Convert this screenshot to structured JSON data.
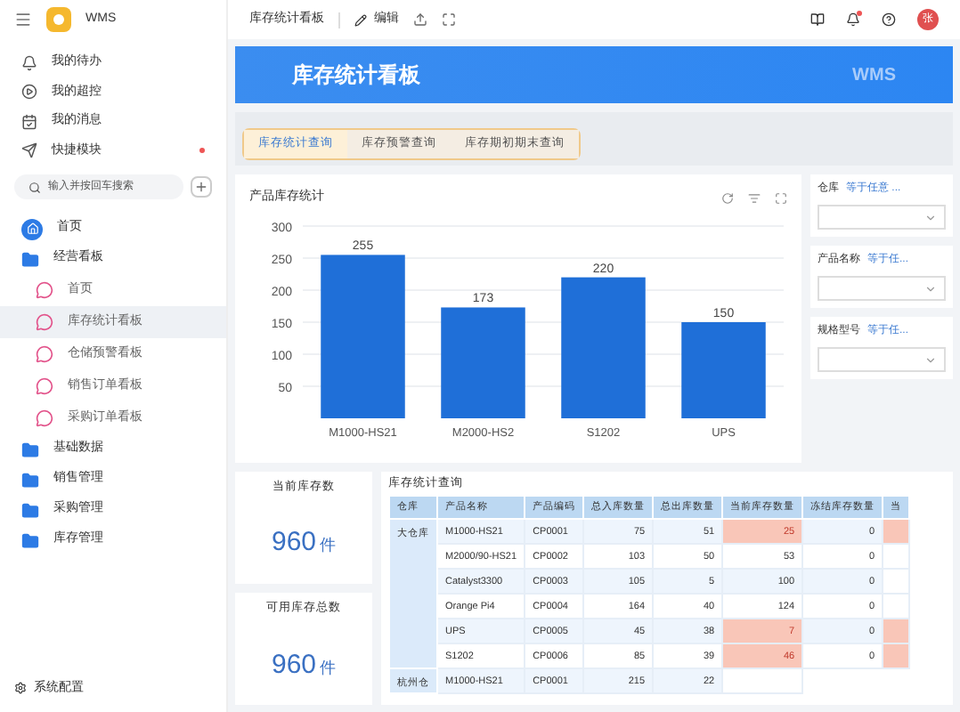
{
  "app": {
    "logo_text": "WMS"
  },
  "sidebar": {
    "shortcuts": [
      {
        "label": "我的待办",
        "badge": false
      },
      {
        "label": "我的超控",
        "badge": false
      },
      {
        "label": "我的消息",
        "badge": false
      },
      {
        "label": "快捷模块",
        "badge": true
      }
    ],
    "search": {
      "placeholder": "输入并按回车搜索"
    },
    "menu": [
      {
        "kind": "home",
        "label": "首页"
      },
      {
        "kind": "folder",
        "label": "经营看板",
        "children": [
          {
            "label": "首页",
            "selected": false
          },
          {
            "label": "库存统计看板",
            "selected": true
          },
          {
            "label": "仓储预警看板",
            "selected": false
          },
          {
            "label": "销售订单看板",
            "selected": false
          },
          {
            "label": "采购订单看板",
            "selected": false
          }
        ]
      },
      {
        "kind": "folder",
        "label": "基础数据"
      },
      {
        "kind": "folder",
        "label": "销售管理"
      },
      {
        "kind": "folder",
        "label": "采购管理"
      },
      {
        "kind": "folder",
        "label": "库存管理"
      }
    ],
    "footer": "系统配置"
  },
  "topbar": {
    "title": "库存统计看板",
    "edit": "编辑",
    "notification_dot": true,
    "avatar": "张"
  },
  "banner": {
    "title": "库存统计看板",
    "mark": "WMS"
  },
  "tabs": [
    {
      "label": "库存统计查询",
      "selected": true
    },
    {
      "label": "库存预警查询",
      "selected": false
    },
    {
      "label": "库存期初期末查询",
      "selected": false
    }
  ],
  "chart_panel": {
    "title": "产品库存统计",
    "chart_data": {
      "type": "bar",
      "categories": [
        "M1000-HS21",
        "M2000-HS2",
        "S1202",
        "UPS"
      ],
      "series": [
        {
          "color": "#1f6fd8",
          "values": [
            255,
            173,
            220,
            150
          ]
        }
      ],
      "ylim": [
        0,
        300
      ],
      "yticks": [
        50,
        100,
        150,
        200,
        250,
        300
      ],
      "grid": true,
      "data_labels": true
    }
  },
  "filters": [
    {
      "label": "仓库",
      "operator": "等于任意 ..."
    },
    {
      "label": "产品名称",
      "operator": "等于任..."
    },
    {
      "label": "规格型号",
      "operator": "等于任..."
    }
  ],
  "stat_cards": [
    {
      "title": "当前库存数",
      "value": "960",
      "unit": "件"
    },
    {
      "title": "可用库存总数",
      "value": "960",
      "unit": "件"
    }
  ],
  "table": {
    "title": "库存统计查询",
    "columns": [
      "仓库",
      "产品名称",
      "产品编码",
      "总入库数量",
      "总出库数量",
      "当前库存数量",
      "冻结库存数量",
      "当"
    ],
    "groups": [
      {
        "warehouse": "大仓库",
        "rows": [
          {
            "cells": [
              "M1000-HS21",
              "CP0001",
              "75",
              "51",
              "25",
              "0"
            ],
            "warning": true
          },
          {
            "cells": [
              "M2000/90-HS21",
              "CP0002",
              "103",
              "50",
              "53",
              "0"
            ],
            "warning": false
          },
          {
            "cells": [
              "Catalyst3300",
              "CP0003",
              "105",
              "5",
              "100",
              "0"
            ],
            "warning": false
          },
          {
            "cells": [
              "Orange Pi4",
              "CP0004",
              "164",
              "40",
              "124",
              "0"
            ],
            "warning": false
          },
          {
            "cells": [
              "UPS",
              "CP0005",
              "45",
              "38",
              "7",
              "0"
            ],
            "warning": true
          },
          {
            "cells": [
              "S1202",
              "CP0006",
              "85",
              "39",
              "46",
              "0"
            ],
            "warning": true
          }
        ]
      },
      {
        "warehouse": "杭州仓",
        "rows": [
          {
            "cells": [
              "M1000-HS21",
              "CP0001",
              "215",
              "22"
            ],
            "warning": false
          }
        ]
      }
    ]
  }
}
